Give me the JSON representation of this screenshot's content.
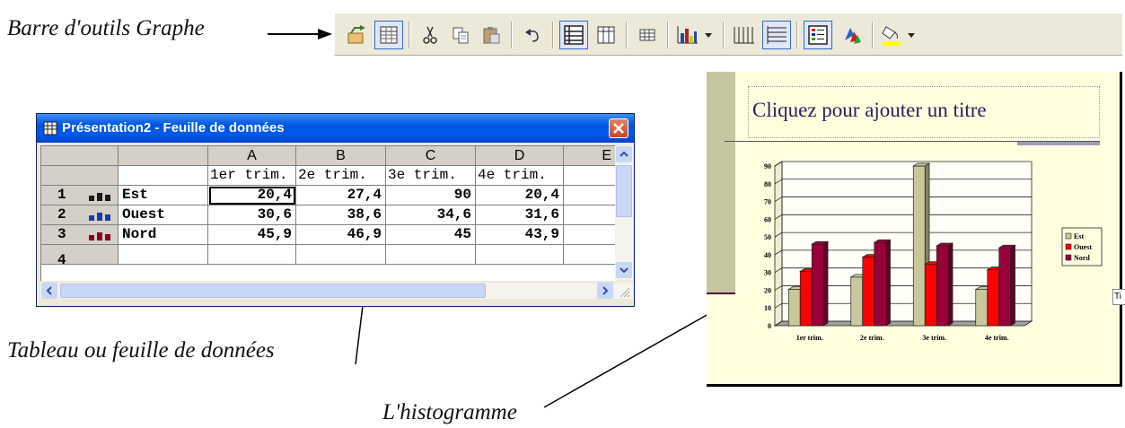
{
  "annotations": {
    "toolbar_label": "Barre d'outils Graphe",
    "sheet_label": "Tableau ou feuille de données",
    "chart_label": "L'histogramme"
  },
  "toolbar": {
    "buttons": [
      {
        "icon": "import-file-icon",
        "active": false
      },
      {
        "icon": "view-datasheet-icon",
        "active": true
      },
      {
        "icon": "cut-icon",
        "active": false
      },
      {
        "icon": "copy-icon",
        "active": false
      },
      {
        "icon": "paste-icon",
        "active": false
      },
      {
        "icon": "undo-icon",
        "active": false
      },
      {
        "icon": "by-row-icon",
        "active": true
      },
      {
        "icon": "by-column-icon",
        "active": false
      },
      {
        "icon": "data-table-icon",
        "active": false
      },
      {
        "icon": "chart-type-icon",
        "active": false
      },
      {
        "icon": "category-gridlines-icon",
        "active": false
      },
      {
        "icon": "value-gridlines-icon",
        "active": true
      },
      {
        "icon": "legend-icon",
        "active": true
      },
      {
        "icon": "drawing-icon",
        "active": false
      },
      {
        "icon": "fill-color-icon",
        "active": false
      }
    ],
    "accent": "#316ac5"
  },
  "sheet": {
    "title": "Présentation2 - Feuille de données",
    "columns": [
      "A",
      "B",
      "C",
      "D",
      "E"
    ],
    "header_row": [
      "1er  trim.",
      "2e  trim.",
      "3e  trim.",
      "4e  trim."
    ],
    "rows": [
      {
        "num": "1",
        "label": "Est",
        "values": [
          "20,4",
          "27,4",
          "90",
          "20,4"
        ]
      },
      {
        "num": "2",
        "label": "Ouest",
        "values": [
          "30,6",
          "38,6",
          "34,6",
          "31,6"
        ]
      },
      {
        "num": "3",
        "label": "Nord",
        "values": [
          "45,9",
          "46,9",
          "45",
          "43,9"
        ]
      }
    ],
    "next_row_num": "4"
  },
  "slide": {
    "title_placeholder": "Cliquez pour ajouter un titre",
    "side_tab": "Ti"
  },
  "chart_data": {
    "type": "bar",
    "categories": [
      "1er trim.",
      "2e trim.",
      "3e trim.",
      "4e trim."
    ],
    "series": [
      {
        "name": "Est",
        "values": [
          20.4,
          27.4,
          90,
          20.4
        ],
        "color": "#c8c89a"
      },
      {
        "name": "Ouest",
        "values": [
          30.6,
          38.6,
          34.6,
          31.6
        ],
        "color": "#ff0000"
      },
      {
        "name": "Nord",
        "values": [
          45.9,
          46.9,
          45,
          43.9
        ],
        "color": "#99003a"
      }
    ],
    "ylim": [
      0,
      90
    ],
    "yticks": [
      "0",
      "10",
      "20",
      "30",
      "40",
      "50",
      "60",
      "70",
      "80",
      "90"
    ],
    "grid": true,
    "legend": "right",
    "three_d": true
  }
}
